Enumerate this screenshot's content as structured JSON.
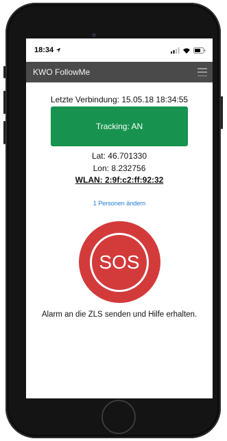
{
  "status": {
    "time": "18:34"
  },
  "app": {
    "title": "KWO FollowMe"
  },
  "main": {
    "last_connection": "Letzte Verbindung: 15.05.18 18:34:55",
    "tracking_label": "Tracking: AN",
    "lat": "Lat: 46.701330",
    "lon": "Lon: 8.232756",
    "wlan": "WLAN: 2:9f:c2:ff:92:32",
    "persons_link": "1 Personen ändern",
    "sos_label": "SOS",
    "alarm_text": "Alarm an die ZLS senden und Hilfe erhalten."
  },
  "colors": {
    "appbar": "#4a4a4a",
    "tracking_green": "#17934f",
    "sos_red": "#d33b3b",
    "link_blue": "#1e7bd8"
  },
  "icons": [
    "location-arrow-icon",
    "signal-icon",
    "wifi-icon",
    "battery-icon",
    "hamburger-menu-icon"
  ]
}
